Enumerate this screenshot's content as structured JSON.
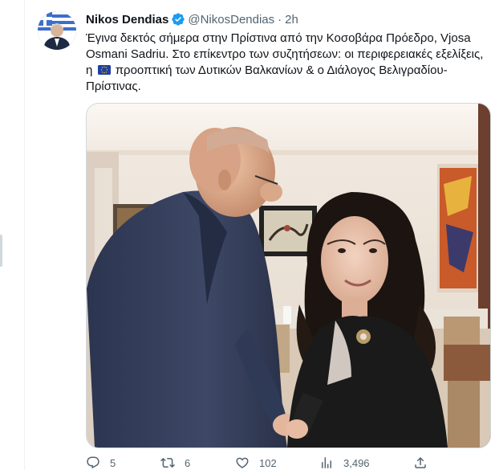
{
  "tweet": {
    "display_name": "Nikos Dendias",
    "handle": "@NikosDendias",
    "separator": "·",
    "time": "2h",
    "text_part1": "Έγινα δεκτός σήμερα στην Πρίστινα από την Κοσοβάρα Πρόεδρο, Vjosa Osmani Sadriu. Στο επίκεντρο των συζητήσεων: οι περιφερειακές εξελίξεις, η",
    "text_part2": "προοπτική των Δυτικών Βαλκανίων & ο Διάλογος Βελιγραδίου-Πρίστινας.",
    "emoji": "EU flag",
    "verified_color": "#1d9bf0"
  },
  "actions": {
    "replies": "5",
    "retweets": "6",
    "likes": "102",
    "views": "3,496"
  },
  "icons": {
    "reply": "reply-icon",
    "retweet": "retweet-icon",
    "like": "heart-icon",
    "views": "views-icon",
    "share": "share-icon"
  }
}
